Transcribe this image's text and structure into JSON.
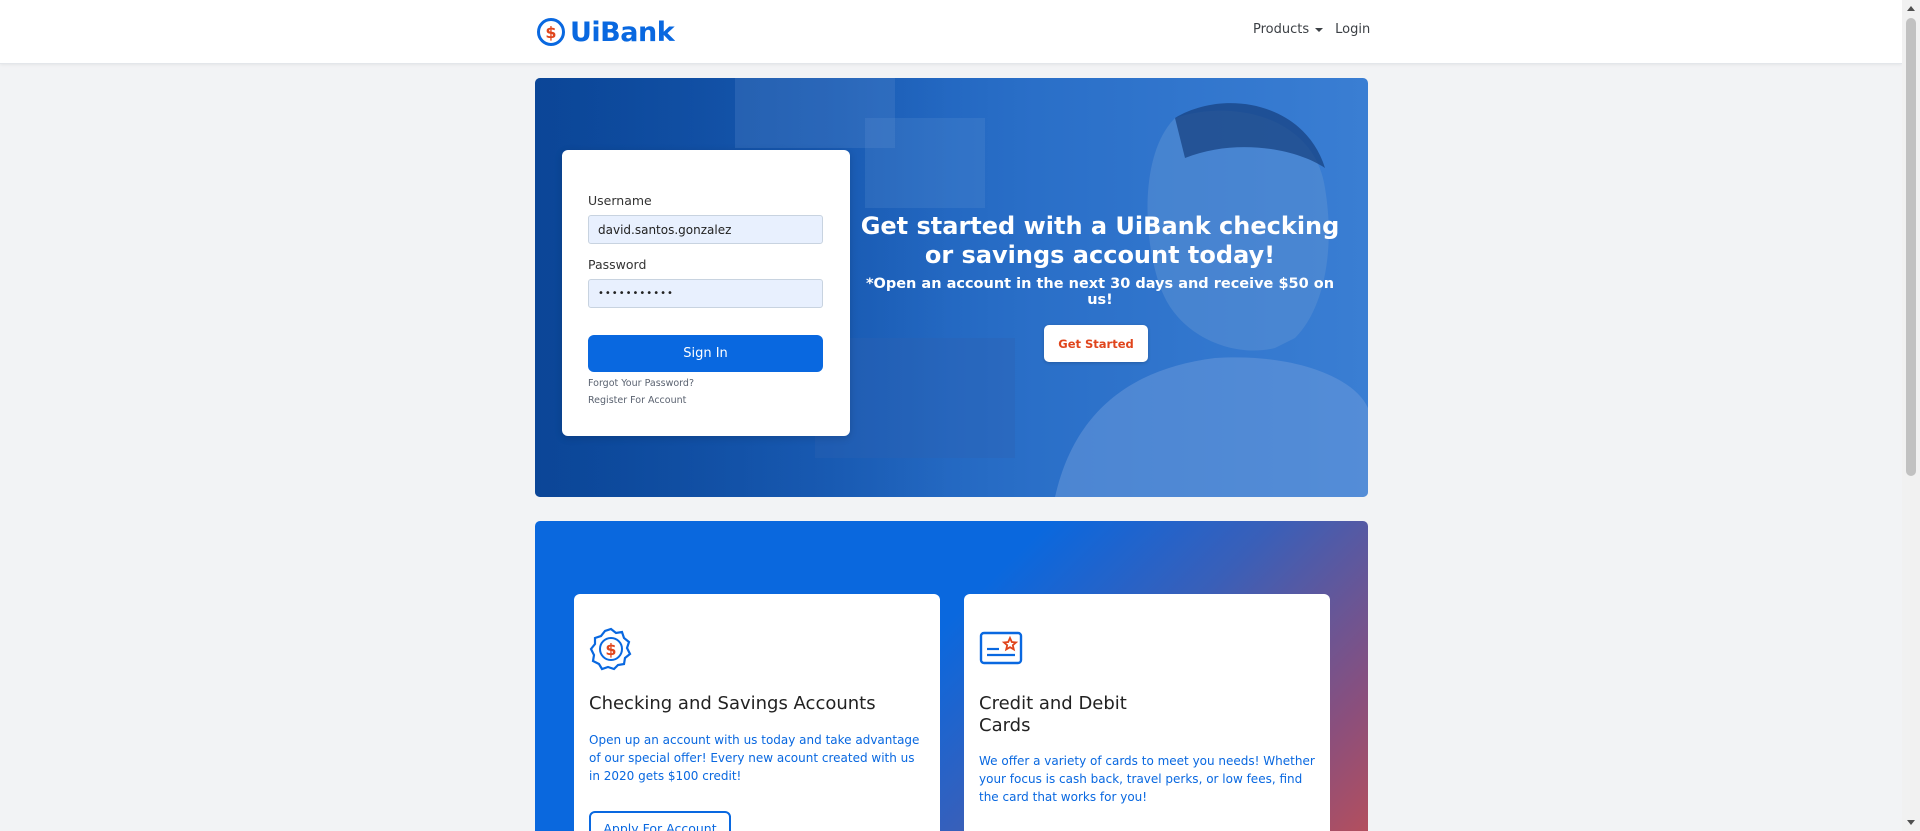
{
  "nav": {
    "brand": "UiBank",
    "products_label": "Products",
    "login_label": "Login"
  },
  "login": {
    "username_label": "Username",
    "username_value": "david.santos.gonzalez",
    "password_label": "Password",
    "password_value": "•••••••••••",
    "signin_label": "Sign In",
    "forgot_label": "Forgot Your Password?",
    "register_label": "Register For Account"
  },
  "hero": {
    "title": "Get started with a UiBank checking or savings account today!",
    "subtitle": "*Open an account in the next 30 days and receive $50 on us!",
    "cta_label": "Get Started"
  },
  "features": [
    {
      "icon": "dollar-badge-icon",
      "title": "Checking and Savings Accounts",
      "text": "Open up an account with us today and take advantage of our special offer! Every new acount created with us in 2020 gets $100 credit!",
      "button_label": "Apply For Account"
    },
    {
      "icon": "credit-card-icon",
      "title": "Credit and Debit Cards",
      "text": "We offer a variety of cards to meet you needs! Whether your focus is cash back, travel perks, or low fees, find the card that works for you!"
    }
  ],
  "colors": {
    "brand": "#0968e0",
    "accent": "#e0451c"
  }
}
